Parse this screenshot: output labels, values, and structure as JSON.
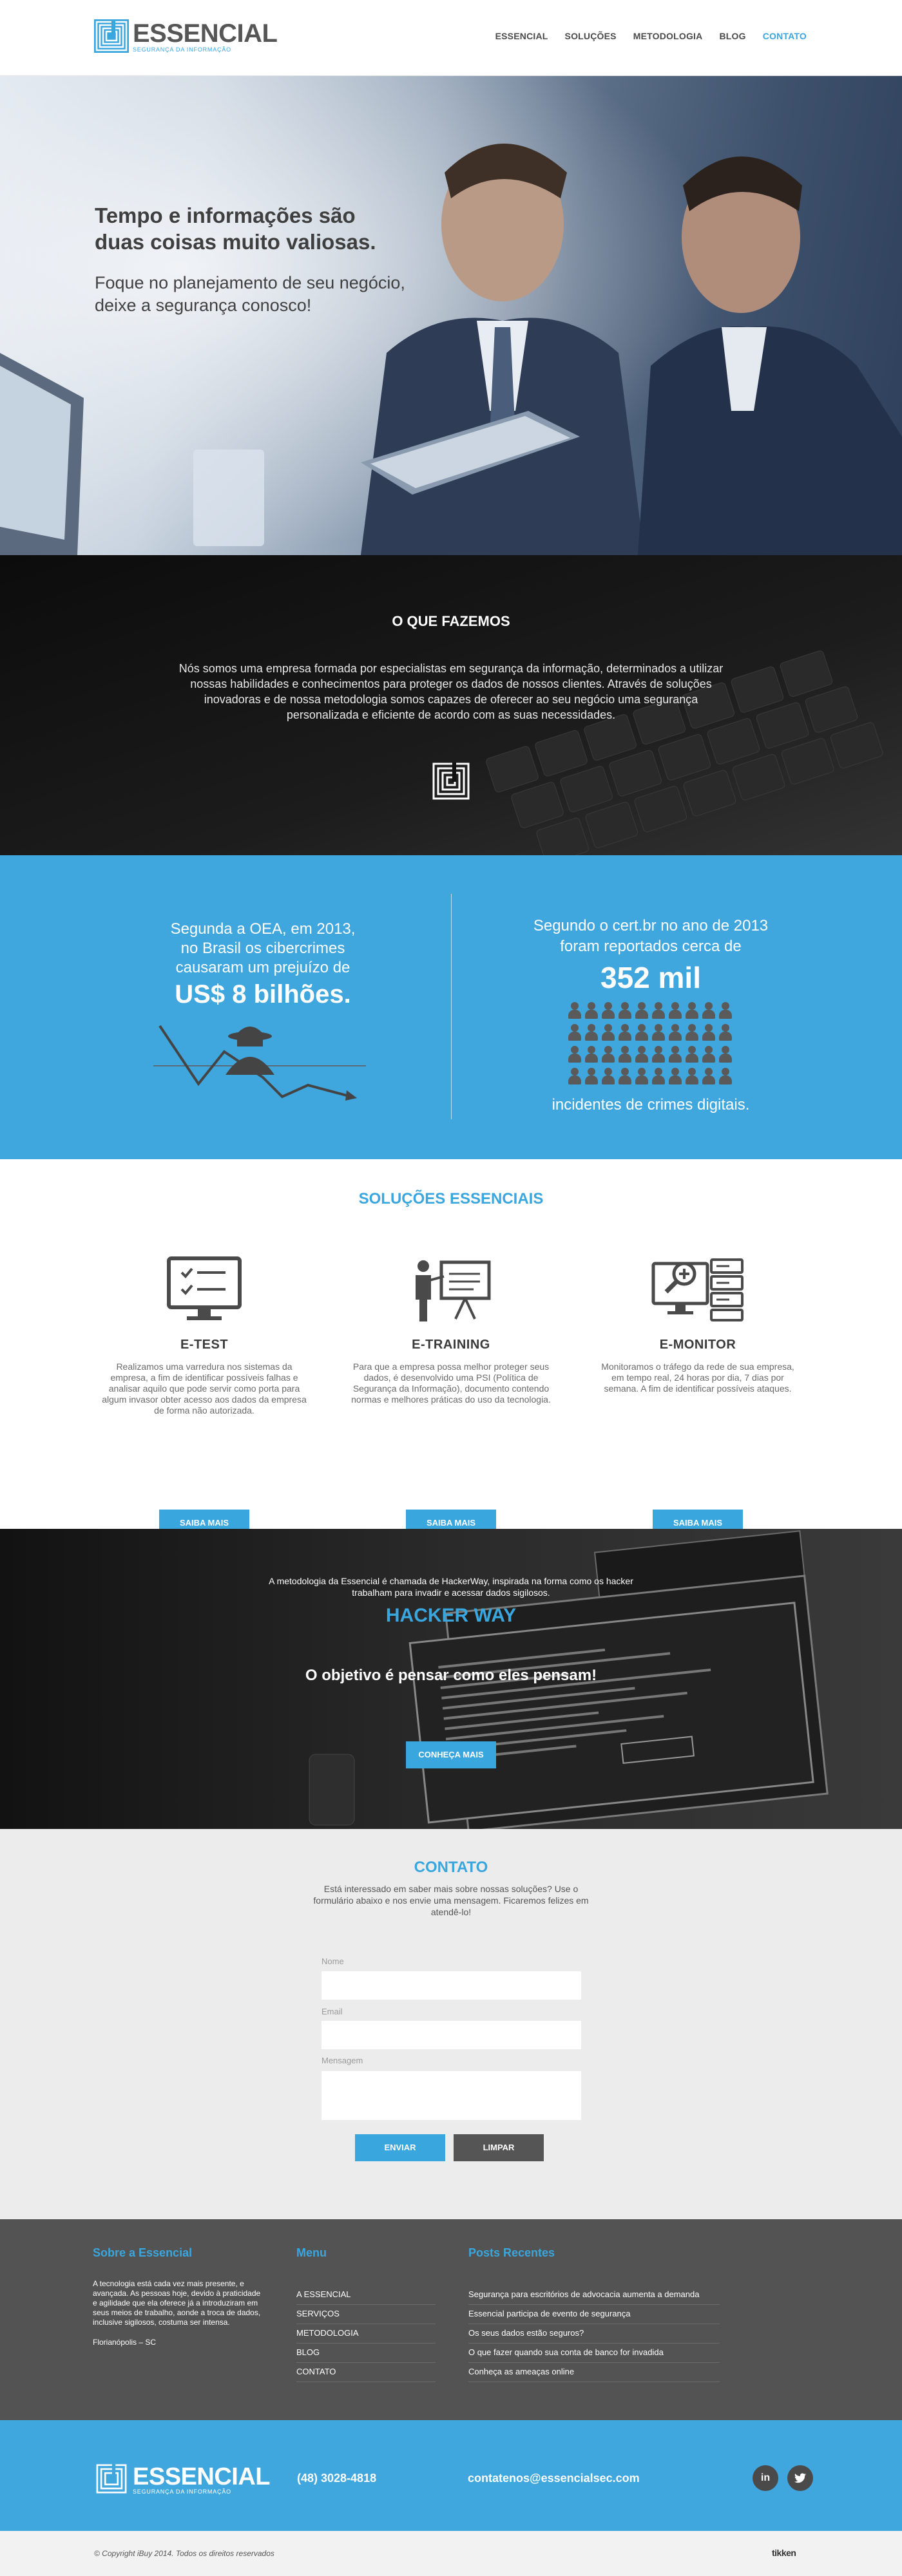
{
  "header": {
    "logo_name": "ESSENCIAL",
    "logo_tagline": "SEGURANÇA DA INFORMAÇÃO",
    "nav": [
      {
        "label": "ESSENCIAL",
        "active": false
      },
      {
        "label": "SOLUÇÕES",
        "active": false
      },
      {
        "label": "METODOLOGIA",
        "active": false
      },
      {
        "label": "BLOG",
        "active": false
      },
      {
        "label": "CONTATO",
        "active": true
      }
    ]
  },
  "hero": {
    "title_line1": "Tempo e informações são",
    "title_line2": "duas coisas muito valiosas.",
    "sub_line1": "Foque no planejamento de seu negócio,",
    "sub_line2": "deixe a segurança conosco!"
  },
  "what_we_do": {
    "title": "O QUE FAZEMOS",
    "text": "Nós somos uma empresa formada por especialistas em segurança da informação, determinados a utilizar nossas habilidades e conhecimentos para proteger os dados de nossos clientes. Através de soluções inovadoras e de nossa metodologia somos capazes de oferecer ao seu negócio uma segurança personalizada e eficiente de acordo com as suas necessidades."
  },
  "stats": {
    "left_line1": "Segunda a OEA, em 2013,",
    "left_line2": "no Brasil os cibercrimes",
    "left_line3": "causaram um prejuízo de",
    "left_value": "US$ 8 bilhões.",
    "right_line1": "Segundo o cert.br no ano de 2013",
    "right_line2": "foram reportados cerca de",
    "right_value": "352 mil",
    "right_foot": "incidentes de crimes digitais."
  },
  "solutions": {
    "title": "SOLUÇÕES ESSENCIAIS",
    "items": [
      {
        "name": "E-TEST",
        "text": "Realizamos uma varredura nos sistemas da empresa, a fim de identificar possíveis falhas e analisar aquilo que pode servir como porta para algum invasor obter acesso aos dados da empresa de forma não autorizada.",
        "button": "SAIBA MAIS"
      },
      {
        "name": "E-TRAINING",
        "text": "Para que a empresa possa melhor proteger seus dados, é desenvolvido uma PSI (Política de Segurança da Informação), documento contendo normas e melhores práticas do uso da tecnologia.",
        "button": "SAIBA MAIS"
      },
      {
        "name": "E-MONITOR",
        "text": "Monitoramos o tráfego da rede de sua empresa, em tempo real, 24 horas por dia, 7 dias por semana. A fim de identificar possíveis ataques.",
        "button": "SAIBA MAIS"
      }
    ]
  },
  "hacker": {
    "intro": "A metodologia da Essencial é chamada de HackerWay, inspirada na forma como os hacker trabalham para invadir e acessar dados sigilosos.",
    "title": "HACKER WAY",
    "tagline": "O objetivo é pensar como eles pensam!",
    "button": "CONHEÇA MAIS"
  },
  "contact": {
    "title": "CONTATO",
    "lead": "Está interessado em saber mais sobre nossas soluções? Use o formulário abaixo e nos envie uma mensagem. Ficaremos felizes em atendê-lo!",
    "name_label": "Nome",
    "email_label": "Email",
    "message_label": "Mensagem",
    "send": "ENVIAR",
    "clear": "LIMPAR"
  },
  "footer": {
    "about_title": "Sobre a Essencial",
    "about_text": "A tecnologia está cada vez mais presente, e avançada. As pessoas hoje, devido à praticidade e agilidade que ela oferece já a introduziram em seus meios de trabalho, aonde a troca de dados, inclusive sigilosos, costuma ser intensa.",
    "location": "Florianópolis – SC",
    "menu_title": "Menu",
    "menu": [
      "A ESSENCIAL",
      "SERVIÇOS",
      "METODOLOGIA",
      "BLOG",
      "CONTATO"
    ],
    "posts_title": "Posts Recentes",
    "posts": [
      "Segurança para escritórios de advocacia aumenta a demanda",
      "Essencial participa de evento de segurança",
      "Os seus dados estão seguros?",
      "O que fazer quando sua conta de banco for invadida",
      "Conheça as ameaças online"
    ],
    "phone": "(48) 3028-4818",
    "email": "contatenos@essencialsec.com",
    "social_linkedin": "in",
    "copyright": "© Copyright iBuy 2014. Todos os direitos reservados",
    "credit": "tikken"
  },
  "colors": {
    "accent": "#3fa7de",
    "dark": "#535353"
  }
}
